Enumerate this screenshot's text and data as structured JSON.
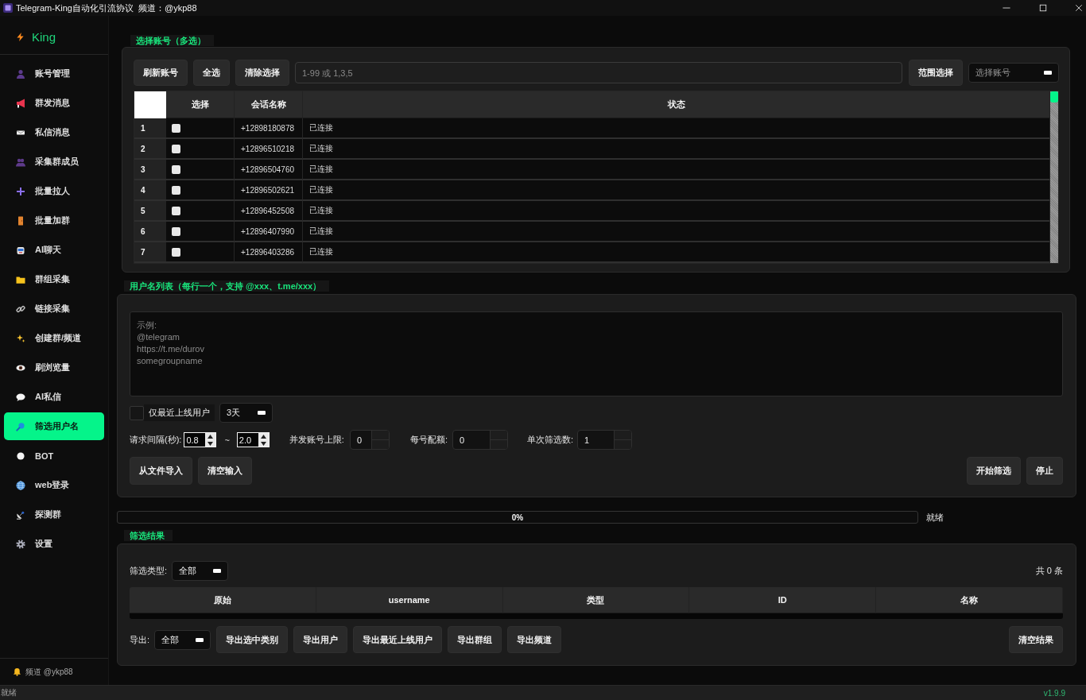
{
  "window": {
    "title": "Telegram-King自动化引流协议  频道：@ykp88"
  },
  "sidebar": {
    "logo": "King",
    "items": [
      {
        "label": "账号管理",
        "selected": false
      },
      {
        "label": "群发消息",
        "selected": false
      },
      {
        "label": "私信消息",
        "selected": false
      },
      {
        "label": "采集群成员",
        "selected": false
      },
      {
        "label": "批量拉人",
        "selected": false
      },
      {
        "label": "批量加群",
        "selected": false
      },
      {
        "label": "AI聊天",
        "selected": false
      },
      {
        "label": "群组采集",
        "selected": false
      },
      {
        "label": "链接采集",
        "selected": false
      },
      {
        "label": "创建群/频道",
        "selected": false
      },
      {
        "label": "刷浏览量",
        "selected": false
      },
      {
        "label": "AI私信",
        "selected": false
      },
      {
        "label": "筛选用户名",
        "selected": true
      },
      {
        "label": "BOT",
        "selected": false
      },
      {
        "label": "web登录",
        "selected": false
      },
      {
        "label": "探测群",
        "selected": false
      },
      {
        "label": "设置",
        "selected": false
      }
    ],
    "footer": "频道 @ykp88"
  },
  "accounts": {
    "title": "选择账号（多选）",
    "buttons": [
      "刷新账号",
      "全选",
      "清除选择"
    ],
    "range_input": {
      "placeholder": "1-99 或 1,3,5"
    },
    "range_button": "范围选择",
    "account_select": {
      "placeholder": "选择账号"
    },
    "table": {
      "columns": [
        "选择",
        "会话名称",
        "状态"
      ],
      "rows": [
        {
          "index": "1",
          "checked": false,
          "name": "+12898180878",
          "status": "已连接"
        },
        {
          "index": "2",
          "checked": false,
          "name": "+12896510218",
          "status": "已连接"
        },
        {
          "index": "3",
          "checked": false,
          "name": "+12896504760",
          "status": "已连接"
        },
        {
          "index": "4",
          "checked": false,
          "name": "+12896502621",
          "status": "已连接"
        },
        {
          "index": "5",
          "checked": false,
          "name": "+12896452508",
          "status": "已连接"
        },
        {
          "index": "6",
          "checked": false,
          "name": "+12896407990",
          "status": "已连接"
        },
        {
          "index": "7",
          "checked": false,
          "name": "+12896403286",
          "status": "已连接"
        }
      ]
    }
  },
  "usernames": {
    "title": "用户名列表（每行一个，支持 @xxx、t.me/xxx）",
    "input": {
      "placeholder": "示例:\n@telegram\nhttps://t.me/durov\nsomegroupname"
    },
    "recent_only": {
      "label": "仅最近上线用户",
      "checked": false
    },
    "recent_days": {
      "value": "3天"
    },
    "interval": {
      "label": "请求间隔(秒):",
      "from": "0.8",
      "separator": "~",
      "to": "2.0"
    },
    "limits": [
      {
        "label": "并发账号上限:",
        "value": "0"
      },
      {
        "label": "每号配额:",
        "value": "0"
      },
      {
        "label": "单次筛选数:",
        "value": "1"
      }
    ],
    "left_buttons": [
      "从文件导入",
      "清空输入"
    ],
    "right_buttons": [
      "开始筛选",
      "停止"
    ]
  },
  "progress": {
    "level": 0,
    "label": "0%",
    "status": "就绪"
  },
  "results": {
    "title": "筛选结果",
    "filter": {
      "label": "筛选类型:",
      "value": "全部"
    },
    "count": "共 0 条",
    "table": {
      "columns": [
        "原始",
        "username",
        "类型",
        "ID",
        "名称"
      ]
    },
    "export": {
      "label": "导出:",
      "value": "全部",
      "buttons": [
        "导出选中类别",
        "导出用户",
        "导出最近上线用户",
        "导出群组",
        "导出频道"
      ]
    },
    "clear_button": "清空结果"
  },
  "status_bar": {
    "text": "就绪",
    "version": "v1.9.9"
  }
}
